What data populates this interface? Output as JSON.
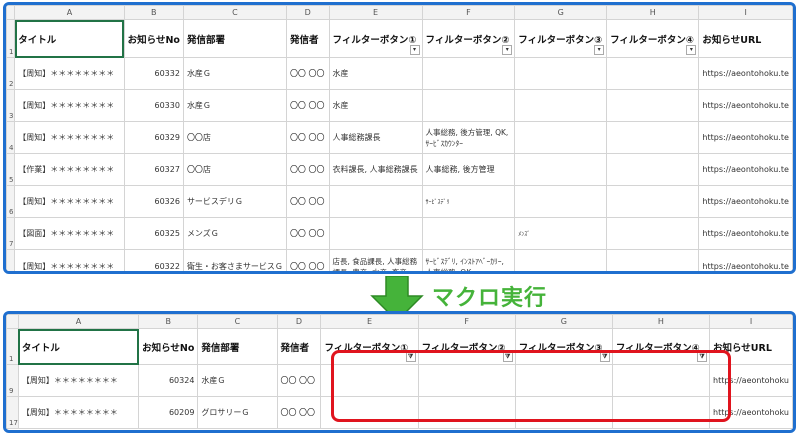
{
  "columns": [
    "A",
    "B",
    "C",
    "D",
    "E",
    "F",
    "G",
    "H",
    "I"
  ],
  "headers": [
    "タイトル",
    "お知らせNo",
    "発信部署",
    "発信者",
    "フィルターボタン①",
    "フィルターボタン②",
    "フィルターボタン③",
    "フィルターボタン④",
    "お知らせURL"
  ],
  "before": {
    "rows": [
      {
        "n": "2",
        "a": "【周知】＊＊＊＊＊＊＊＊",
        "b": "60332",
        "c": "水産Ｇ",
        "d": "〇〇 〇〇",
        "e": "水産",
        "f": "",
        "g": "",
        "h": "",
        "i": "https://aeontohoku.te"
      },
      {
        "n": "3",
        "a": "【周知】＊＊＊＊＊＊＊＊",
        "b": "60330",
        "c": "水産Ｇ",
        "d": "〇〇 〇〇",
        "e": "水産",
        "f": "",
        "g": "",
        "h": "",
        "i": "https://aeontohoku.te"
      },
      {
        "n": "4",
        "a": "【周知】＊＊＊＊＊＊＊＊",
        "b": "60329",
        "c": "〇〇店",
        "d": "〇〇 〇〇",
        "e": "人事総務課長",
        "f": "人事総務, 後方管理, QK, ｻｰﾋﾞｽｶｳﾝﾀｰ",
        "g": "",
        "h": "",
        "i": "https://aeontohoku.te"
      },
      {
        "n": "5",
        "a": "【作業】＊＊＊＊＊＊＊＊",
        "b": "60327",
        "c": "〇〇店",
        "d": "〇〇 〇〇",
        "e": "衣料課長, 人事総務課長",
        "f": "人事総務, 後方管理",
        "g": "",
        "h": "",
        "i": "https://aeontohoku.te"
      },
      {
        "n": "6",
        "a": "【周知】＊＊＊＊＊＊＊＊",
        "b": "60326",
        "c": "サービスデリＧ",
        "d": "〇〇 〇〇",
        "e": "",
        "f": "ｻｰﾋﾞｽﾃﾞﾘ",
        "g": "",
        "h": "",
        "i": "https://aeontohoku.te"
      },
      {
        "n": "7",
        "a": "【図面】＊＊＊＊＊＊＊＊",
        "b": "60325",
        "c": "メンズＧ",
        "d": "〇〇 〇〇",
        "e": "",
        "f": "",
        "g": "ﾒﾝｽﾞ",
        "h": "",
        "i": "https://aeontohoku.te"
      },
      {
        "n": "8",
        "a": "【周知】＊＊＊＊＊＊＊＊",
        "b": "60322",
        "c": "衛生・お客さまサービスＧ",
        "d": "〇〇 〇〇",
        "e": "店長, 食品課長, 人事総務課長, 農産, 水産, 畜産",
        "f": "ｻｰﾋﾞｽﾃﾞﾘ, ｲﾝｽﾄｱﾍﾞｰｶﾘｰ, 人事総務, QK",
        "g": "",
        "h": "",
        "i": "https://aeontohoku.te"
      }
    ]
  },
  "macro_label": "マクロ実行",
  "after": {
    "rows": [
      {
        "n": "9",
        "a": "【周知】＊＊＊＊＊＊＊＊",
        "b": "60324",
        "c": "水産Ｇ",
        "d": "〇〇 〇〇",
        "i": "https://aeontohoku"
      },
      {
        "n": "17",
        "a": "【周知】＊＊＊＊＊＊＊＊",
        "b": "60209",
        "c": "グロサリーＧ",
        "d": "〇〇 〇〇",
        "i": "https://aeontohoku"
      }
    ]
  },
  "filter_icon": "filter-dropdown-icon",
  "colors": {
    "panel_border": "#1f6fcf",
    "highlight": "#e0141e",
    "arrow": "#45b33a"
  }
}
